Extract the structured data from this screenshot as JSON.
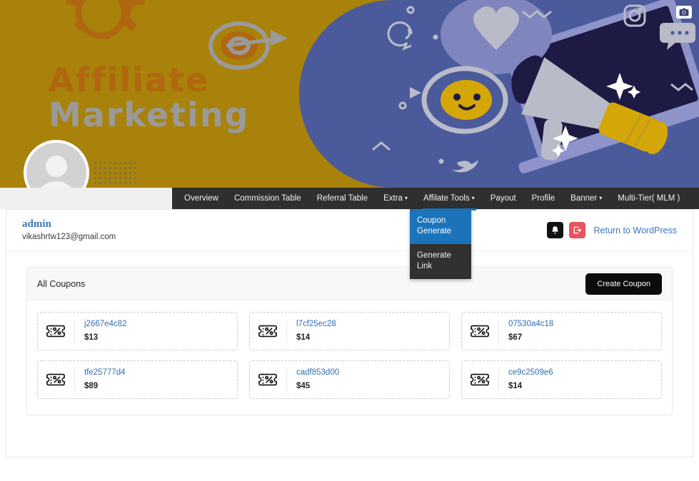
{
  "banner": {
    "headline_line1": "Affiliate",
    "headline_line2": "Marketing",
    "camera_icon": "camera-icon",
    "colors": {
      "gold": "#a8820a",
      "blue": "#4a5a9b",
      "orange": "#b0670f",
      "gray": "#9a9a9a"
    }
  },
  "nav": {
    "items": [
      {
        "label": "Overview",
        "caret": false,
        "active": false
      },
      {
        "label": "Commission Table",
        "caret": false,
        "active": false
      },
      {
        "label": "Referral Table",
        "caret": false,
        "active": false
      },
      {
        "label": "Extra",
        "caret": true,
        "active": false
      },
      {
        "label": "Affilate Tools",
        "caret": true,
        "active": true
      },
      {
        "label": "Payout",
        "caret": false,
        "active": false
      },
      {
        "label": "Profile",
        "caret": false,
        "active": false
      },
      {
        "label": "Banner",
        "caret": true,
        "active": false
      },
      {
        "label": "Multi-Tier( MLM )",
        "caret": false,
        "active": false
      }
    ],
    "caret_glyph": "▾",
    "active_color": "#1b74ba"
  },
  "dropdown": {
    "items": [
      {
        "label": "Coupon Generate",
        "selected": true
      },
      {
        "label": "Generate Link",
        "selected": false
      }
    ],
    "highlight_color": "#1b74ba"
  },
  "user": {
    "name": "admin",
    "email": "vikashrtw123@gmail.com",
    "bell_icon": "bell-icon",
    "logout_icon": "logout-icon",
    "wp_link": "Return to WordPress",
    "link_color": "#3c76b8",
    "logout_color": "#e8545b"
  },
  "coupons_panel": {
    "title": "All Coupons",
    "create_button": "Create Coupon",
    "coupon_icon": "ticket-percent-icon",
    "items": [
      {
        "code": "j2667e4c82",
        "amount": "$13"
      },
      {
        "code": "l7cf25ec28",
        "amount": "$14"
      },
      {
        "code": "07530a4c18",
        "amount": "$67"
      },
      {
        "code": "tfe25777d4",
        "amount": "$89"
      },
      {
        "code": "cadf853d00",
        "amount": "$45"
      },
      {
        "code": "ce9c2509e6",
        "amount": "$14"
      }
    ]
  }
}
